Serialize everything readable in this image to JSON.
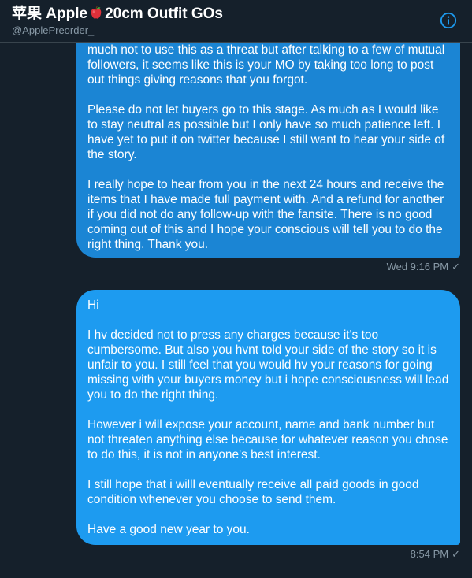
{
  "header": {
    "title_prefix": "苹果 Apple",
    "title_suffix": "20cm Outfit GOs",
    "handle": "@ApplePreorder_",
    "emoji_icon": "red-apple-emoji",
    "info_icon": "info-icon"
  },
  "colors": {
    "background": "#15202b",
    "accent": "#1d9bf0",
    "muted_text": "#8899a6"
  },
  "messages": [
    {
      "paragraphs": [
        "much not to use this as a threat but after talking to a few of mutual followers, it seems like this is your MO by taking too long to post out things giving reasons that you forgot.",
        "Please do not let buyers go to this stage. As much as I would like to stay neutral as possible but I only have so much patience left. I have yet to put it on twitter because I still want to hear your side of the story.",
        "I really hope to hear from you in the next 24 hours and receive the items that I have made full payment with. And a refund for another if you did not do any follow-up with the fansite. There is no good coming out of this and I hope your conscious will tell you to do the right thing. Thank you."
      ],
      "timestamp": "Wed 9:16 PM",
      "status": "✓"
    },
    {
      "paragraphs": [
        "Hi",
        "I hv decided not to press any charges because it's too cumbersome. But also you hvnt told your side of the story so it is unfair to you. I still feel that you would hv your reasons for going missing with your buyers money but i hope consciousness will lead you to do the right thing.",
        "However i will expose your account, name and bank number but not threaten anything else because for whatever reason you chose to do this, it is not in anyone's best interest.",
        "I still hope that i willl eventually receive all paid goods in good condition whenever you choose to send them.",
        "Have a good new year to you."
      ],
      "timestamp": "8:54 PM",
      "status": "✓"
    }
  ]
}
